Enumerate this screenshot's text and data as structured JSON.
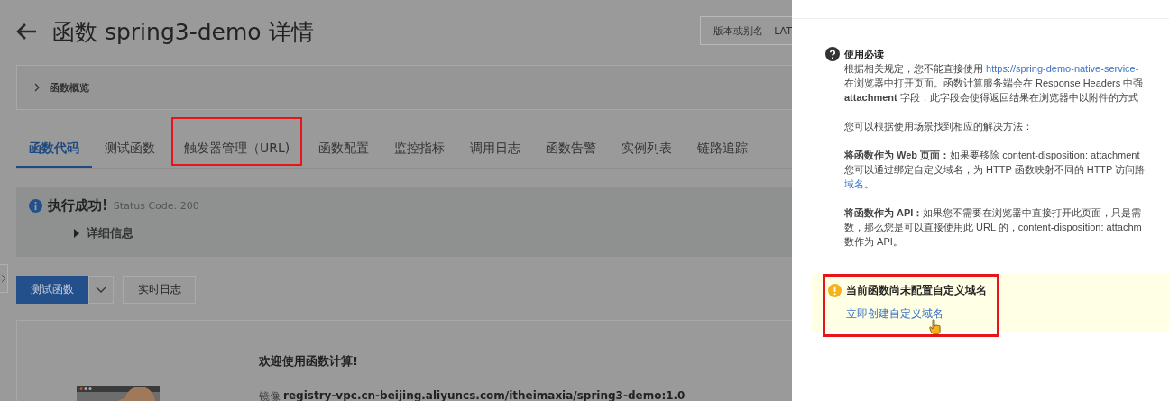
{
  "page": {
    "title": "函数 spring3-demo 详情",
    "version_select": {
      "label": "版本或别名",
      "value": "LAT"
    },
    "overview": {
      "label": "函数概览",
      "expanded": false
    },
    "tabs": [
      {
        "label": "函数代码",
        "selected": true,
        "highlighted": false
      },
      {
        "label": "测试函数",
        "selected": false,
        "highlighted": false
      },
      {
        "label": "触发器管理（URL)",
        "selected": false,
        "highlighted": true
      },
      {
        "label": "函数配置",
        "selected": false,
        "highlighted": false
      },
      {
        "label": "监控指标",
        "selected": false,
        "highlighted": false
      },
      {
        "label": "调用日志",
        "selected": false,
        "highlighted": false
      },
      {
        "label": "函数告警",
        "selected": false,
        "highlighted": false
      },
      {
        "label": "实例列表",
        "selected": false,
        "highlighted": false
      },
      {
        "label": "链路追踪",
        "selected": false,
        "highlighted": false
      }
    ],
    "result": {
      "title": "执行成功!",
      "status": "Status Code: 200",
      "details": {
        "label": "详细信息",
        "expanded": false
      }
    },
    "buttons": {
      "primary": "测试函数",
      "secondary": "实时日志"
    },
    "welcome": {
      "title": "欢迎使用函数计算!",
      "image_label": "镜像",
      "image": "registry-vpc.cn-beijing.aliyuncs.com/itheimaxia/spring3-demo:1.0"
    }
  },
  "drawer": {
    "notice_title": "使用必读",
    "paragraphs": [
      {
        "lines": [
          {
            "text": "根据相关规定，您不能直接使用 ",
            "link": "https://spring-demo-native-service-"
          },
          {
            "text": "在浏览器中打开页面。函数计算服务端会在 Response Headers 中强"
          },
          {
            "text": "**attachment** 字段，此字段会使得返回结果在浏览器中以附件的方式"
          }
        ]
      },
      {
        "lines": [
          {
            "text": "您可以根据使用场景找到相应的解决方法："
          }
        ]
      },
      {
        "lines": [
          {
            "text": "**将函数作为 Web 页面：**如果要移除 content-disposition: attachment"
          },
          {
            "text": "您可以通过绑定自定义域名，为 HTTP 函数映射不同的 HTTP 访问路"
          },
          {
            "link": "域名",
            "text_after": "。"
          }
        ]
      },
      {
        "lines": [
          {
            "text": "**将函数作为 API：**如果您不需要在浏览器中直接打开此页面，只是需"
          },
          {
            "text": "数，那么您是可以直接使用此 URL 的，content-disposition: attachm"
          },
          {
            "text": "数作为 API。"
          }
        ]
      }
    ],
    "warning": {
      "title": "当前函数尚未配置自定义域名",
      "link": "立即创建自定义域名",
      "highlighted": true
    }
  }
}
